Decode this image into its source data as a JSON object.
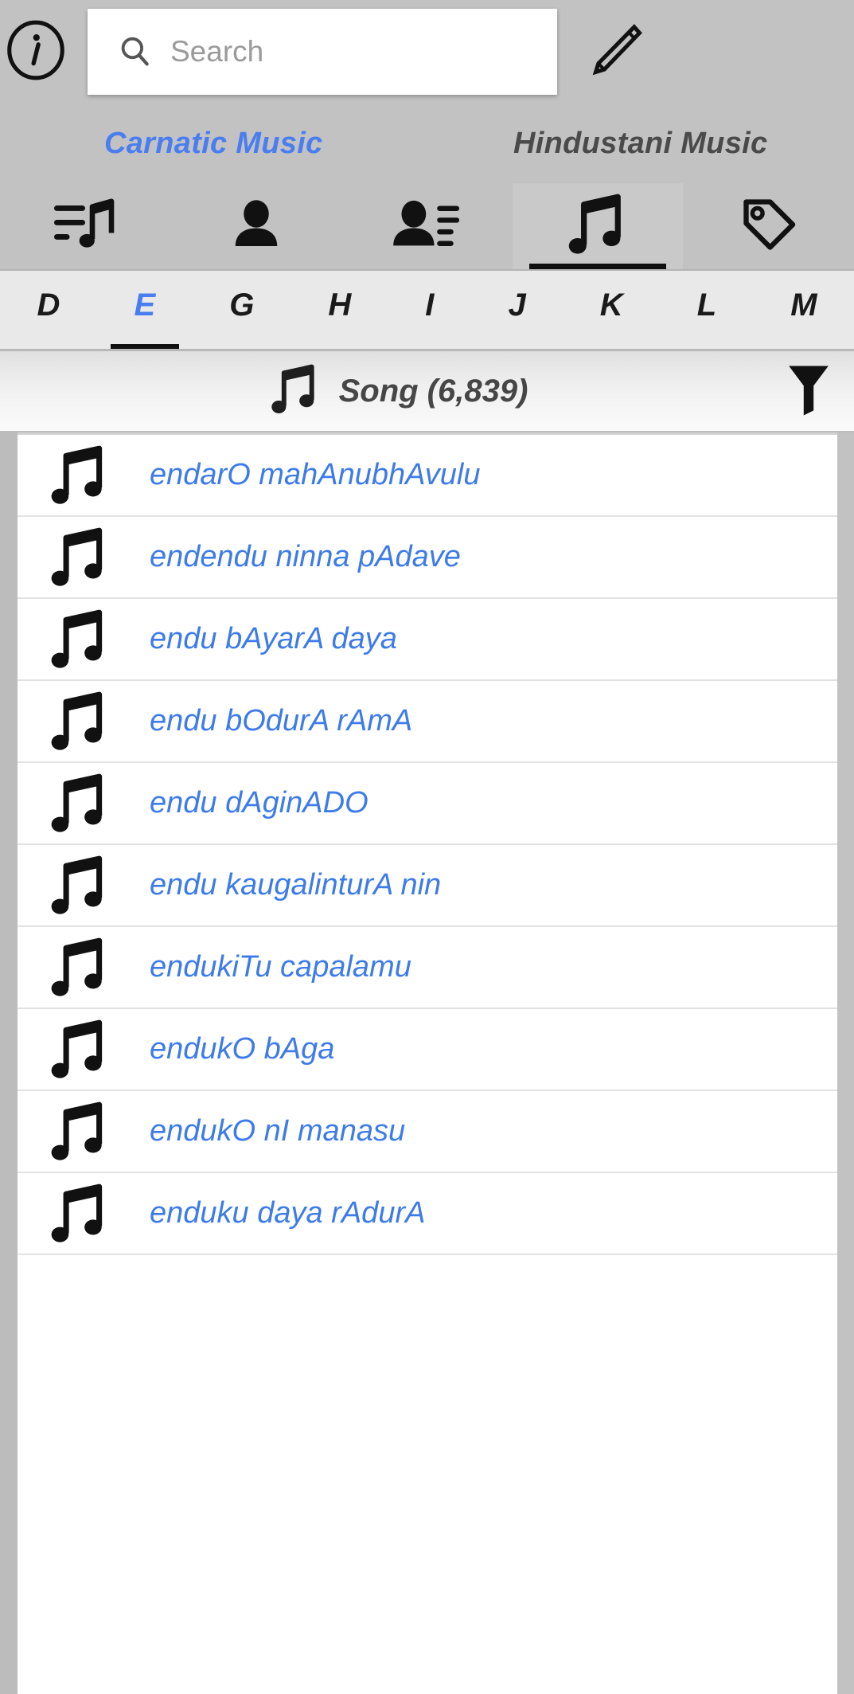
{
  "topbar": {
    "info_icon": "info-circle-icon",
    "search": {
      "icon": "search-icon",
      "value": "",
      "placeholder": "Search"
    },
    "edit_icon": "pencil-edit-icon"
  },
  "genre_tabs": {
    "items": [
      {
        "label": "Carnatic Music",
        "active": true
      },
      {
        "label": "Hindustani Music",
        "active": false
      }
    ],
    "active_color": "#4a7ef0",
    "inactive_color": "#4a4a4a"
  },
  "category_icons": {
    "items": [
      {
        "name": "queue-music-icon",
        "selected": false
      },
      {
        "name": "person-icon",
        "selected": false
      },
      {
        "name": "person-list-icon",
        "selected": false
      },
      {
        "name": "music-note-icon",
        "selected": true
      },
      {
        "name": "tag-icon",
        "selected": false
      }
    ]
  },
  "alphabet_bar": {
    "items": [
      {
        "letter": "D",
        "active": false
      },
      {
        "letter": "E",
        "active": true
      },
      {
        "letter": "G",
        "active": false
      },
      {
        "letter": "H",
        "active": false
      },
      {
        "letter": "I",
        "active": false
      },
      {
        "letter": "J",
        "active": false
      },
      {
        "letter": "K",
        "active": false
      },
      {
        "letter": "L",
        "active": false
      },
      {
        "letter": "M",
        "active": false
      }
    ]
  },
  "section_header": {
    "icon": "music-note-icon",
    "title": "Song (6,839)",
    "filter_icon": "filter-funnel-icon"
  },
  "song_list": {
    "row_icon": "music-note-icon",
    "link_color": "#3d7bea",
    "items": [
      {
        "title": "endarO mahAnubhAvulu"
      },
      {
        "title": "endendu ninna pAdave"
      },
      {
        "title": "endu bAyarA daya"
      },
      {
        "title": "endu bOdurA rAmA"
      },
      {
        "title": "endu dAginADO"
      },
      {
        "title": "endu kaugalinturA nin"
      },
      {
        "title": "endukiTu capalamu"
      },
      {
        "title": "endukO bAga"
      },
      {
        "title": "endukO nI manasu"
      },
      {
        "title": "enduku daya rAdurA"
      }
    ]
  }
}
